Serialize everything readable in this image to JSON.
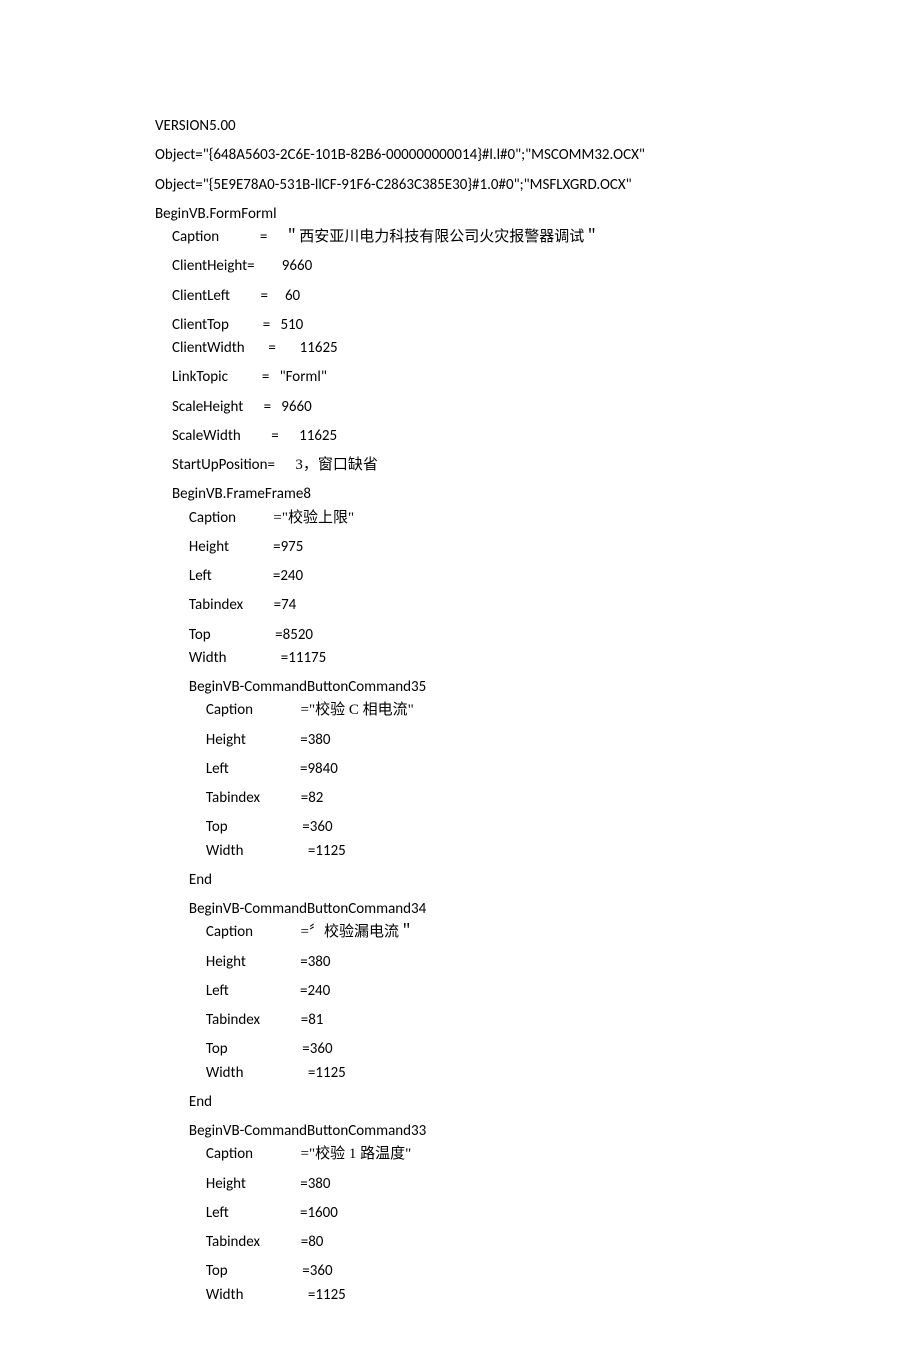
{
  "version": "VERSION5.00",
  "objects": [
    "Object=\"{648A5603-2C6E-101B-82B6-000000000014}#l.l#0\";\"MSCOMM32.OCX\"",
    "Object=\"{5E9E78A0-531B-llCF-91F6-C2863C385E30}#1.0#0\";\"MSFLXGRD.OCX\""
  ],
  "form": {
    "begin": "BeginVB.FormForml",
    "caption_key": "Caption",
    "caption_val": "＂西安亚川电力科技有限公司火灾报警器调试＂",
    "clientHeight_key": "ClientHeight",
    "clientHeight_eq": "=",
    "clientHeight_val": "9660",
    "clientLeft_key": "ClientLeft",
    "clientLeft_eq": "=",
    "clientLeft_val": "60",
    "clientTop_key": "ClientTop",
    "clientTop_eq": "=",
    "clientTop_val": "510",
    "clientWidth_key": "ClientWidth",
    "clientWidth_eq": "=",
    "clientWidth_val": "11625",
    "linkTopic_key": "LinkTopic",
    "linkTopic_eq": "=",
    "linkTopic_val": "\"Forml\"",
    "scaleHeight_key": "ScaleHeight",
    "scaleHeight_eq": "=",
    "scaleHeight_val": "9660",
    "scaleWidth_key": "ScaleWidth",
    "scaleWidth_eq": "=",
    "scaleWidth_val": "11625",
    "startUpPos_key": "StartUpPosition",
    "startUpPos_eq": "=",
    "startUpPos_val": "3，窗口缺省"
  },
  "frame8": {
    "begin": "BeginVB.FrameFrame8",
    "caption_key": "Caption",
    "caption_val": "=\"校验上限\"",
    "height_key": "Height",
    "height_val": "=975",
    "left_key": "Left",
    "left_val": "=240",
    "tabindex_key": "Tabindex",
    "tabindex_val": "=74",
    "top_key": "Top",
    "top_val": "=8520",
    "width_key": "Width",
    "width_val": "=11175"
  },
  "cmd35": {
    "begin": "BeginVB-CommandButtonCommand35",
    "caption_key": "Caption",
    "caption_val": "=\"校验 C 相电流\"",
    "height_key": "Height",
    "height_val": "=380",
    "left_key": "Left",
    "left_val": "=9840",
    "tabindex_key": "Tabindex",
    "tabindex_val": "=82",
    "top_key": "Top",
    "top_val": "=360",
    "width_key": "Width",
    "width_val": "=1125",
    "end": "End"
  },
  "cmd34": {
    "begin": "BeginVB-CommandButtonCommand34",
    "caption_key": "Caption",
    "caption_val": "=〞校验漏电流＂",
    "height_key": "Height",
    "height_val": "=380",
    "left_key": "Left",
    "left_val": "=240",
    "tabindex_key": "Tabindex",
    "tabindex_val": "=81",
    "top_key": "Top",
    "top_val": "=360",
    "width_key": "Width",
    "width_val": "=1125",
    "end": "End"
  },
  "cmd33": {
    "begin": "BeginVB-CommandButtonCommand33",
    "caption_key": "Caption",
    "caption_val": "=\"校验 1 路温度\"",
    "height_key": "Height",
    "height_val": "=380",
    "left_key": "Left",
    "left_val": "=1600",
    "tabindex_key": "Tabindex",
    "tabindex_val": "=80",
    "top_key": "Top",
    "top_val": "=360",
    "width_key": "Width",
    "width_val": "=1125"
  }
}
